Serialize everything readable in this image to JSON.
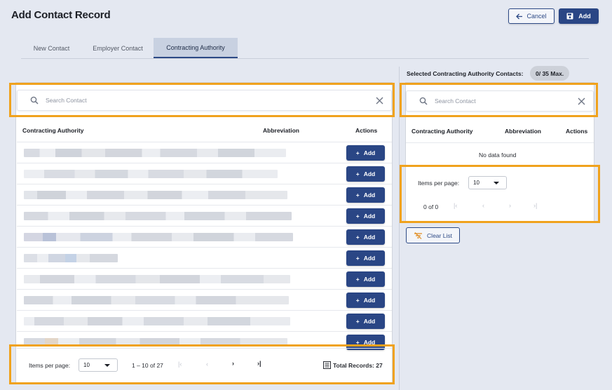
{
  "page_title": "Add Contact Record",
  "header_buttons": {
    "cancel": "Cancel",
    "add": "Add"
  },
  "tabs": [
    {
      "label": "New Contact",
      "active": false
    },
    {
      "label": "Employer Contact",
      "active": false
    },
    {
      "label": "Contracting Authority",
      "active": true
    }
  ],
  "left": {
    "search_placeholder": "Search Contact",
    "columns": [
      "Contracting Authority",
      "Abbreviation",
      "Actions"
    ],
    "row_action_label": "Add",
    "rows_note": "10 rows of pixelated / obscured authority names",
    "pagination": {
      "items_per_page_label": "Items per page:",
      "items_per_page_value": "10",
      "range": "1 – 10 of 27",
      "total_records": "Total Records: 27"
    }
  },
  "right": {
    "selected_label": "Selected Contracting Authority Contacts:",
    "selected_count": "0/ 35 Max.",
    "search_placeholder": "Search Contact",
    "columns": [
      "Contracting Authority",
      "Abbreviation",
      "Actions"
    ],
    "empty_message": "No data found",
    "pagination": {
      "items_per_page_label": "Items per page:",
      "items_per_page_value": "10",
      "range": "0 of 0"
    },
    "clear_button": "Clear List"
  },
  "colors": {
    "primary": "#2a4685",
    "background": "#e4e8f1",
    "highlight": "#f0a21d"
  }
}
